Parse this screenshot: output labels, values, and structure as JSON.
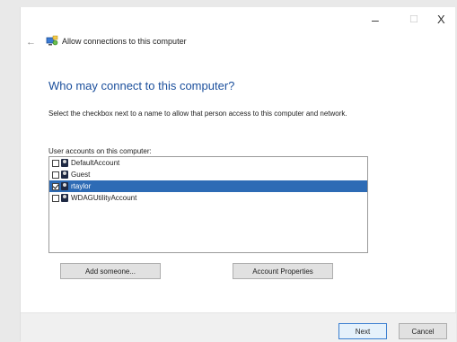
{
  "window": {
    "controls": {
      "minimize": "–",
      "maximize": "☐",
      "close": "X"
    },
    "back_glyph": "←",
    "header_title": "Allow connections to this computer"
  },
  "main": {
    "heading": "Who may connect to this computer?",
    "instructions": "Select the checkbox next to a name to allow that person access to this computer and network.",
    "list_label": "User accounts on this computer:",
    "accounts": [
      {
        "name": "DefaultAccount",
        "checked": false,
        "selected": false
      },
      {
        "name": "Guest",
        "checked": false,
        "selected": false
      },
      {
        "name": "rtaylor",
        "checked": true,
        "selected": true
      },
      {
        "name": "WDAGUtilityAccount",
        "checked": false,
        "selected": false
      }
    ],
    "add_button": "Add someone...",
    "properties_button": "Account Properties"
  },
  "footer": {
    "next_button": "Next",
    "cancel_button": "Cancel"
  },
  "colors": {
    "heading": "#1b4f9c",
    "selection": "#2d6bb5"
  },
  "icons": [
    "back-arrow-icon",
    "network-connection-icon",
    "user-account-icon"
  ]
}
